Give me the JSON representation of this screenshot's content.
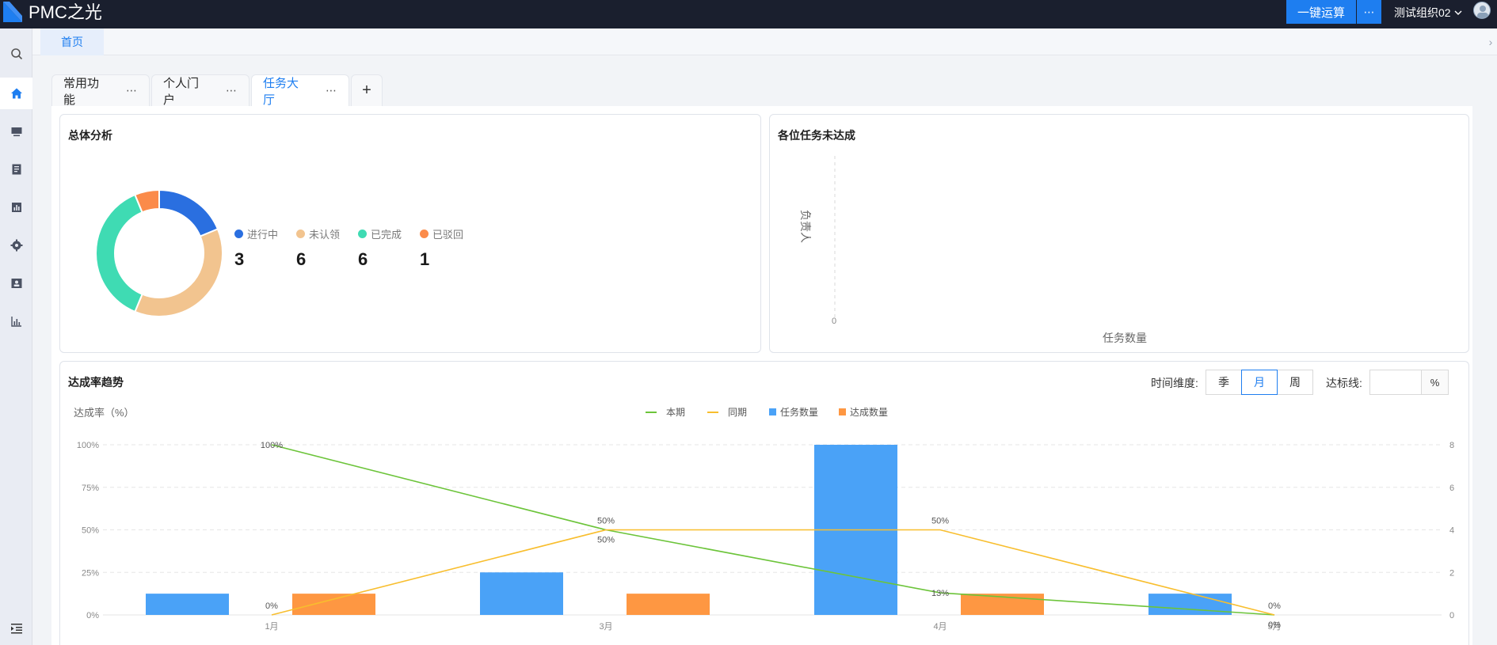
{
  "topbar": {
    "app_title": "PMC之光",
    "run_button": "一键运算",
    "more_button": "⋯",
    "org_name": "测试组织02"
  },
  "page_tabs": {
    "home": "首页"
  },
  "portal_tabs": [
    {
      "label": "常用功能",
      "more": "⋯"
    },
    {
      "label": "个人门户",
      "more": "⋯"
    },
    {
      "label": "任务大厅",
      "more": "⋯",
      "active": true
    }
  ],
  "portal_add": "+",
  "overview": {
    "title": "总体分析",
    "items": [
      {
        "label": "进行中",
        "value": 3,
        "color": "#2a6fe0"
      },
      {
        "label": "未认领",
        "value": 6,
        "color": "#f2c48f"
      },
      {
        "label": "已完成",
        "value": 6,
        "color": "#3fdbb3"
      },
      {
        "label": "已驳回",
        "value": 1,
        "color": "#fb8b4a"
      }
    ]
  },
  "pending": {
    "title": "各位任务未达成",
    "y_axis_label": "负责人",
    "x_axis_label": "任务数量",
    "x_tick": "0"
  },
  "trend": {
    "title": "达成率趋势",
    "time_dim_label": "时间维度:",
    "time_options": [
      {
        "label": "季",
        "active": false
      },
      {
        "label": "月",
        "active": true
      },
      {
        "label": "周",
        "active": false
      }
    ],
    "target_label": "达标线:",
    "target_value": "",
    "target_unit": "%"
  },
  "colors": {
    "accent": "#1e7ef0",
    "topbar": "#1a1f2e",
    "current_line": "#6cc43a",
    "yoy_line": "#f8be2e",
    "task_bar": "#4aa2f7",
    "done_bar": "#fe9742"
  },
  "chart_data": {
    "type": "bar",
    "y_axis_label": "达成率（%）",
    "categories": [
      "1月",
      "3月",
      "4月",
      "5月"
    ],
    "y_left": {
      "range": [
        0,
        100
      ],
      "ticks": [
        "0%",
        "25%",
        "50%",
        "75%",
        "100%"
      ]
    },
    "y_right": {
      "range": [
        0,
        8
      ],
      "ticks": [
        "0",
        "2",
        "4",
        "6",
        "8"
      ]
    },
    "legend": [
      "本期",
      "同期",
      "任务数量",
      "达成数量"
    ],
    "legend_position": "top-center",
    "grid": true,
    "series": [
      {
        "name": "任务数量",
        "kind": "bar",
        "axis": "right",
        "values": [
          1,
          2,
          8,
          1
        ]
      },
      {
        "name": "达成数量",
        "kind": "bar",
        "axis": "right",
        "values": [
          1,
          1,
          1,
          0
        ]
      },
      {
        "name": "本期",
        "kind": "line",
        "axis": "left",
        "values": [
          100,
          50,
          13,
          0
        ],
        "labels": [
          "100%",
          "50%",
          "13%",
          "0%"
        ]
      },
      {
        "name": "同期",
        "kind": "line",
        "axis": "left",
        "values": [
          0,
          50,
          50,
          0
        ],
        "labels": [
          "0%",
          "50%",
          "50%",
          "0%"
        ]
      }
    ]
  }
}
